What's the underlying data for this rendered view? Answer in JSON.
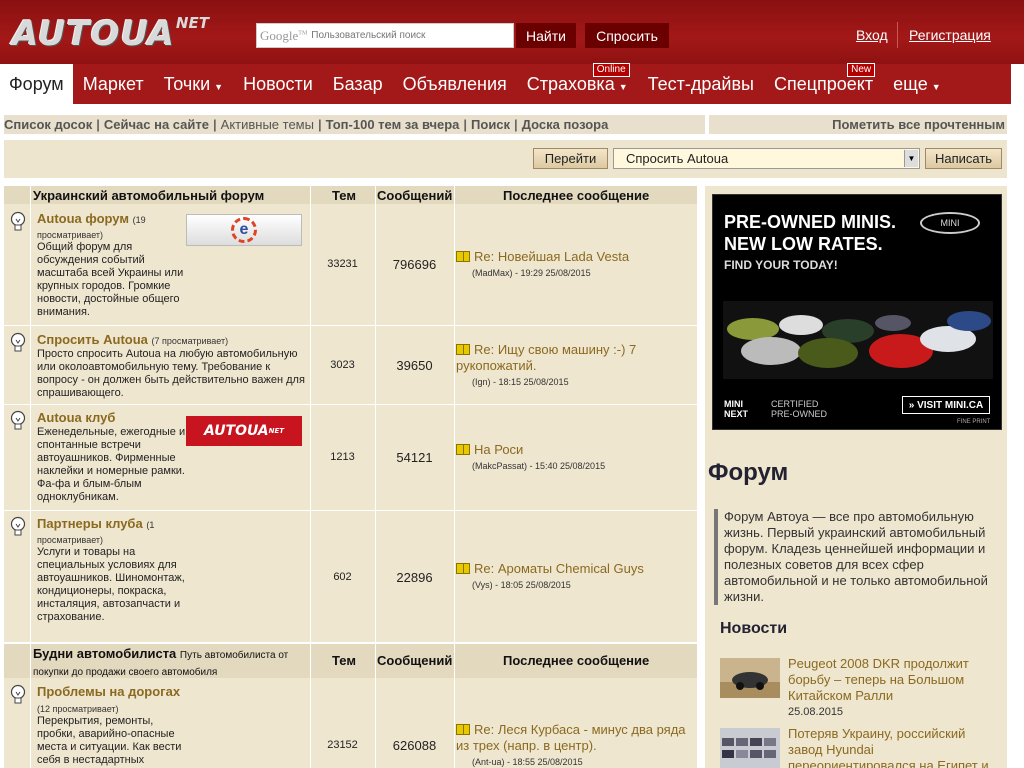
{
  "header": {
    "logo_main": "AUTOUA",
    "logo_sup": "NET",
    "search_brand": "Google",
    "search_brand_tm": "TM",
    "search_placeholder": "Пользовательский поиск",
    "find_button": "Найти",
    "ask_button": "Спросить",
    "login": "Вход",
    "register": "Регистрация"
  },
  "nav": {
    "items": [
      {
        "label": "Форум"
      },
      {
        "label": "Маркет"
      },
      {
        "label": "Точки"
      },
      {
        "label": "Новости"
      },
      {
        "label": "Базар"
      },
      {
        "label": "Объявления"
      },
      {
        "label": "Страховка",
        "badge": "Online"
      },
      {
        "label": "Тест-драйвы"
      },
      {
        "label": "Спецпроект",
        "badge": "New"
      },
      {
        "label": "еще"
      }
    ]
  },
  "subnav": {
    "links": [
      "Список досок",
      "Сейчас на сайте",
      "Активные темы",
      "Топ-100 тем за вчера",
      "Поиск",
      "Доска позора"
    ],
    "mark_read": "Пометить все прочтенным"
  },
  "jump": {
    "go_button": "Перейти",
    "selected": "Спросить Autoua",
    "write_button": "Написать"
  },
  "columns": {
    "topics": "Тем",
    "messages": "Сообщений",
    "last": "Последнее сообщение"
  },
  "section1": {
    "title": "Украинский автомобильный форум",
    "forums": [
      {
        "title": "Autoua форум",
        "viewers": "(19 просматривает)",
        "desc": "Общий форум для обсуждения событий масштаба всей Украины или крупных городов. Громкие новости, достойные общего внимания.",
        "topics": "33231",
        "messages": "796696",
        "last_title": "Re: Новейшая Lada Vesta",
        "last_meta": "(MadMax) - 19:29 25/08/2015"
      },
      {
        "title": "Спросить Autoua",
        "viewers": "(7 просматривает)",
        "desc": "Просто спросить Autoua на любую автомобильную или околоавтомобильную тему. Требование к вопросу - он должен быть действительно важен для спрашивающего.",
        "topics": "3023",
        "messages": "39650",
        "last_title": "Re: Ищу свою машину :-) 7 рукопожатий.",
        "last_meta": "(Ign) - 18:15 25/08/2015"
      },
      {
        "title": "Autoua клуб",
        "viewers": "",
        "desc": "Еженедельные, ежегодные и спонтанные встречи автоуашников. Фирменные наклейки и номерные рамки. Фа-фа и блым-блым одноклубникам.",
        "topics": "1213",
        "messages": "54121",
        "last_title": "На Роси",
        "last_meta": "(MakcPassat) - 15:40 25/08/2015"
      },
      {
        "title": "Партнеры клуба",
        "viewers": "(1 просматривает)",
        "desc": "Услуги и товары на специальных условиях для автоуашников. Шиномонтаж, кондиционеры, покраска, инсталяция, автозапчасти и страхование.",
        "topics": "602",
        "messages": "22896",
        "last_title": "Re: Ароматы Chemical Guys",
        "last_meta": "(Vys) - 18:05 25/08/2015"
      }
    ]
  },
  "section2": {
    "title": "Будни автомобилиста",
    "subtitle": "Путь автомобилиста от покупки до продажи своего автомобиля",
    "forums": [
      {
        "title": "Проблемы на дорогах",
        "viewers": "(12 просматривает)",
        "desc": "Перекрытия, ремонты, пробки, аварийно-опасные места и ситуации. Как вести себя в нестадартных",
        "topics": "23152",
        "messages": "626088",
        "last_title": "Re: Леся Курбаса - минус два ряда из трех (напр. в центр).",
        "last_meta": "(Ant-ua) - 18:55 25/08/2015"
      }
    ]
  },
  "ad": {
    "headline1": "PRE-OWNED MINIS.",
    "headline2": "NEW LOW RATES.",
    "sub": "FIND YOUR TODAY!",
    "brand": "MINI",
    "foot1a": "MINI",
    "foot1b": "NEXT",
    "foot2a": "CERTIFIED",
    "foot2b": "PRE-OWNED",
    "visit": "» VISIT MINI.CA",
    "fine": "FINE PRINT"
  },
  "sidebar": {
    "title": "Форум",
    "desc": "Форум Автоуа — все про автомобильную жизнь. Первый украинский автомобильный форум. Кладезь ценнейшей информации и полезных советов для всех сфер автомобильной и не только автомобильной жизни.",
    "news_title": "Новости",
    "news": [
      {
        "text": "Peugeot 2008 DKR продолжит борьбу – теперь на Большом Китайском Ралли",
        "date": "25.08.2015"
      },
      {
        "text": "Потеряв Украину, российский завод Hyundai переориентировался на Египет и",
        "date": ""
      }
    ]
  }
}
